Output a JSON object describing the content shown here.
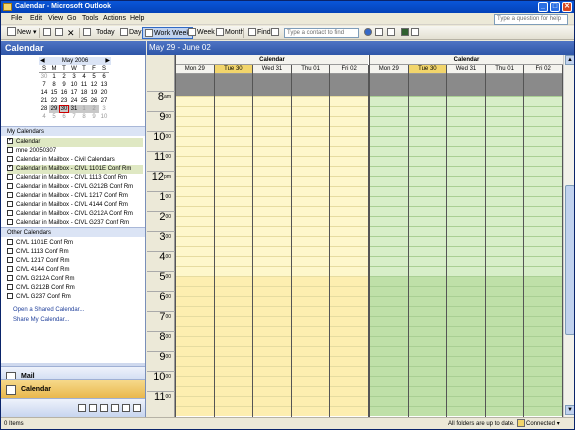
{
  "window": {
    "title": "Calendar - Microsoft Outlook",
    "minimize": "_",
    "maximize": "□",
    "close": "✕"
  },
  "menu": {
    "items": [
      "File",
      "Edit",
      "View",
      "Go",
      "Tools",
      "Actions",
      "Help"
    ],
    "help_placeholder": "Type a question for help"
  },
  "toolbar": {
    "new_label": "New",
    "today_label": "Today",
    "day_label": "Day",
    "work_week_label": "Work Week",
    "week_label": "Week",
    "month_label": "Month",
    "find_label": "Find",
    "contact_placeholder": "Type a contact to find"
  },
  "nav": {
    "title": "Calendar",
    "minical": {
      "month": "May 2006",
      "prev": "◀",
      "next": "▶",
      "dow": [
        "S",
        "M",
        "T",
        "W",
        "T",
        "F",
        "S"
      ],
      "days": [
        [
          "30",
          "1",
          "2",
          "3",
          "4",
          "5",
          "6"
        ],
        [
          "7",
          "8",
          "9",
          "10",
          "11",
          "12",
          "13"
        ],
        [
          "14",
          "15",
          "16",
          "17",
          "18",
          "19",
          "20"
        ],
        [
          "21",
          "22",
          "23",
          "24",
          "25",
          "26",
          "27"
        ],
        [
          "28",
          "29",
          "30",
          "31",
          "1",
          "2",
          "3"
        ],
        [
          "4",
          "5",
          "6",
          "7",
          "8",
          "9",
          "10"
        ]
      ]
    },
    "my_calendars_title": "My Calendars",
    "my_calendars": [
      {
        "label": "Calendar",
        "checked": true
      },
      {
        "label": "mne 20050307",
        "checked": false
      },
      {
        "label": "Calendar in Mailbox - Civil Calendars",
        "checked": false
      },
      {
        "label": "Calendar in Mailbox - CIVL 1101E Conf Rm",
        "checked": true
      },
      {
        "label": "Calendar in Mailbox - CIVL 1113 Conf Rm",
        "checked": false
      },
      {
        "label": "Calendar in Mailbox - CIVL G212B Conf Rm",
        "checked": false
      },
      {
        "label": "Calendar in Mailbox - CIVL 1217 Conf Rm",
        "checked": false
      },
      {
        "label": "Calendar in Mailbox - CIVL 4144 Conf Rm",
        "checked": false
      },
      {
        "label": "Calendar in Mailbox - CIVL G212A Conf Rm",
        "checked": false
      },
      {
        "label": "Calendar in Mailbox - CIVL G237 Conf Rm",
        "checked": false
      }
    ],
    "other_calendars_title": "Other Calendars",
    "other_calendars": [
      "CIVL 1101E Conf Rm",
      "CIVL 1113 Conf Rm",
      "CIVL 1217 Conf Rm",
      "CIVL 4144 Conf Rm",
      "CIVL G212A Conf Rm",
      "CIVL G212B Conf Rm",
      "CIVL G237 Conf Rm"
    ],
    "open_shared": "Open a Shared Calendar...",
    "share_my": "Share My Calendar...",
    "mail_button": "Mail",
    "calendar_button": "Calendar"
  },
  "main": {
    "date_range": "May 29 - June 02",
    "calendars": [
      {
        "title": "Calendar",
        "color_work": "#fef7cb",
        "color_off": "#fdeeb0",
        "line": "#e6dca0"
      },
      {
        "title": "Calendar",
        "color_work": "#d7eec8",
        "color_off": "#bfe0a8",
        "line": "#a9cf93"
      }
    ],
    "days": [
      "Mon 29",
      "Tue 30",
      "Wed 31",
      "Thu 01",
      "Fri 02"
    ],
    "hours": [
      {
        "h": "8",
        "m": "am"
      },
      {
        "h": "9",
        "m": "00"
      },
      {
        "h": "10",
        "m": "00"
      },
      {
        "h": "11",
        "m": "00"
      },
      {
        "h": "12",
        "m": "pm"
      },
      {
        "h": "1",
        "m": "00"
      },
      {
        "h": "2",
        "m": "00"
      },
      {
        "h": "3",
        "m": "00"
      },
      {
        "h": "4",
        "m": "00"
      },
      {
        "h": "5",
        "m": "00"
      },
      {
        "h": "6",
        "m": "00"
      },
      {
        "h": "7",
        "m": "00"
      },
      {
        "h": "8",
        "m": "00"
      },
      {
        "h": "9",
        "m": "00"
      },
      {
        "h": "10",
        "m": "00"
      },
      {
        "h": "11",
        "m": "00"
      }
    ]
  },
  "status": {
    "items": "0 Items",
    "sync": "All folders are up to date.",
    "connection": "Connected"
  }
}
